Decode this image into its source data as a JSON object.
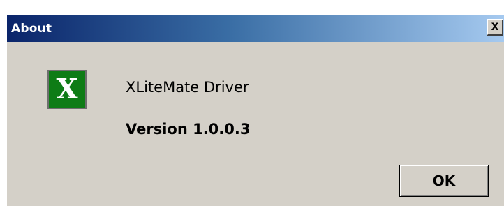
{
  "window": {
    "title": "About",
    "close_label": "X"
  },
  "app_icon": {
    "glyph": "X",
    "icon_name": "xlitemate-app-icon",
    "color": "#0e7c16"
  },
  "content": {
    "product_name": "XLiteMate Driver",
    "version": "Version 1.0.0.3"
  },
  "buttons": {
    "ok_label": "OK"
  },
  "colors": {
    "titlebar_start": "#0a246a",
    "titlebar_end": "#a6caf0",
    "dialog_background": "#d4d0c8"
  }
}
